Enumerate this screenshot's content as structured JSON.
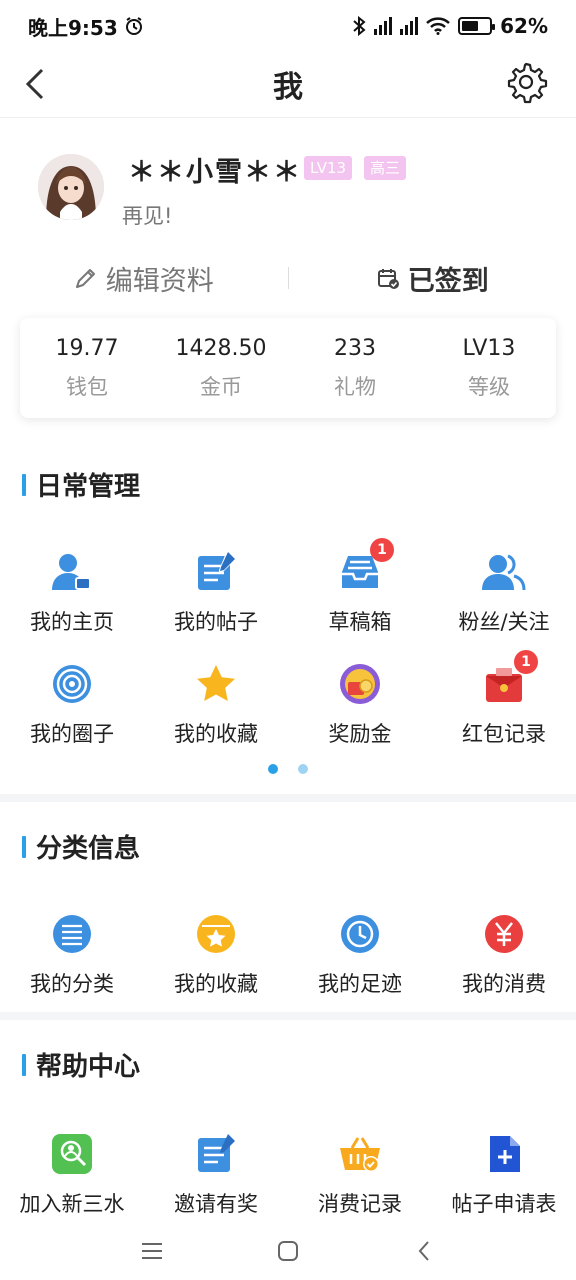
{
  "status_bar": {
    "time": "晚上9:53",
    "battery": "62%",
    "battery_level": 0.62
  },
  "header": {
    "title": "我"
  },
  "profile": {
    "username": "＊＊小雪＊＊",
    "level_badge": "LV13",
    "grade_badge": "高三",
    "signature": "再见!",
    "badge_color": "#f3c4ef"
  },
  "actions": {
    "edit_profile": "编辑资料",
    "checked_in": "已签到"
  },
  "stats": [
    {
      "value": "19.77",
      "label": "钱包"
    },
    {
      "value": "1428.50",
      "label": "金币"
    },
    {
      "value": "233",
      "label": "礼物"
    },
    {
      "value": "LV13",
      "label": "等级"
    }
  ],
  "sections": {
    "daily": {
      "title": "日常管理",
      "items": [
        {
          "label": "我的主页",
          "icon": "user-home-icon"
        },
        {
          "label": "我的帖子",
          "icon": "post-icon"
        },
        {
          "label": "草稿箱",
          "icon": "drafts-icon",
          "badge": "1"
        },
        {
          "label": "粉丝/关注",
          "icon": "fans-icon"
        },
        {
          "label": "我的圈子",
          "icon": "circle-icon"
        },
        {
          "label": "我的收藏",
          "icon": "star-icon"
        },
        {
          "label": "奖励金",
          "icon": "reward-icon"
        },
        {
          "label": "红包记录",
          "icon": "red-packet-icon",
          "badge": "1"
        }
      ]
    },
    "category": {
      "title": "分类信息",
      "items": [
        {
          "label": "我的分类",
          "icon": "list-icon"
        },
        {
          "label": "我的收藏",
          "icon": "favorite-icon"
        },
        {
          "label": "我的足迹",
          "icon": "clock-icon"
        },
        {
          "label": "我的消费",
          "icon": "yen-icon"
        }
      ]
    },
    "help": {
      "title": "帮助中心",
      "items": [
        {
          "label": "加入新三水",
          "icon": "join-icon"
        },
        {
          "label": "邀请有奖",
          "icon": "invite-icon"
        },
        {
          "label": "消费记录",
          "icon": "basket-icon"
        },
        {
          "label": "帖子申请表",
          "icon": "apply-form-icon"
        }
      ]
    }
  },
  "colors": {
    "accent": "#2ba0e6",
    "icon_blue": "#3d8fe0",
    "badge_red": "#f04343"
  }
}
